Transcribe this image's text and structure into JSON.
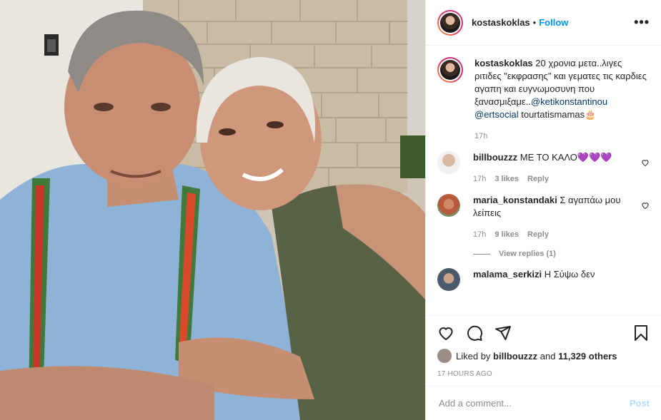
{
  "post": {
    "username": "kostaskoklas",
    "follow_label": "Follow",
    "separator": "•",
    "more_label": "•••"
  },
  "caption": {
    "username": "kostaskoklas",
    "text": "20 χρονια μετα..λιγες ριτιδες \"εκφρασης\" και γεματες τις καρδιες αγαπη και ευγνωμοσυνη που ξανασμιξαμε..",
    "mention1": "@ketikonstantinou",
    "mention2": "@ertsocial",
    "tail": "tourtatismamas🎂",
    "time": "17h"
  },
  "comments": [
    {
      "username": "billbouzzz",
      "text": "ΜΕ ΤΟ ΚΑΛΟ💜💜💜",
      "time": "17h",
      "likes": "3 likes",
      "reply": "Reply"
    },
    {
      "username": "maria_konstandaki",
      "text": "Σ αγαπάω μου λείπεις",
      "time": "17h",
      "likes": "9 likes",
      "reply": "Reply"
    },
    {
      "username": "malama_serkizi",
      "text": "Η Σύψω δεν"
    }
  ],
  "view_replies": "View replies (1)",
  "likes": {
    "prefix": "Liked by",
    "user": "billbouzzz",
    "and": "and",
    "others": "11,329 others"
  },
  "timestamp": "17 HOURS AGO",
  "add_comment": {
    "placeholder": "Add a comment...",
    "post_label": "Post"
  },
  "colors": {
    "accent": "#0095f6",
    "post_disabled": "#b2dffc",
    "muted": "#8e8e8e"
  }
}
